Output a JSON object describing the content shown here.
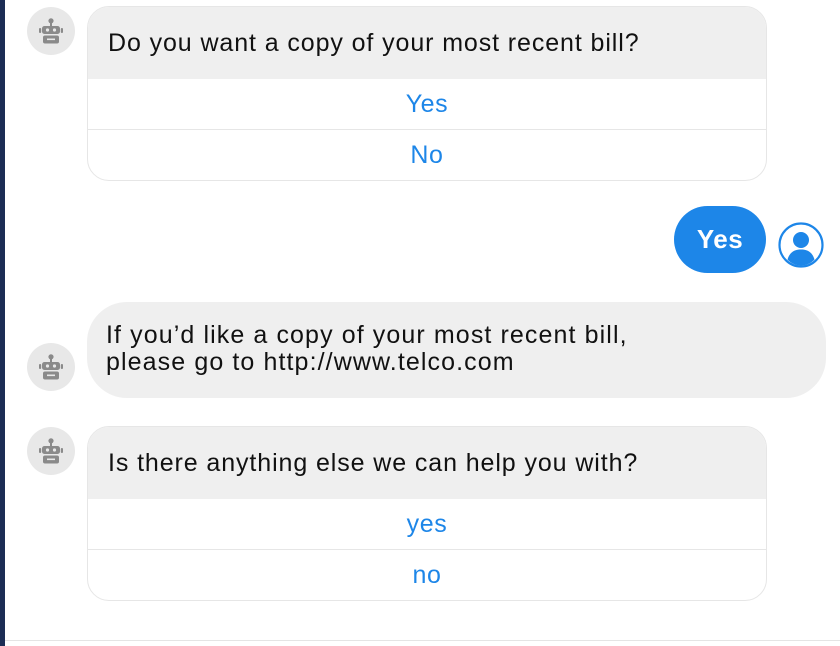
{
  "conversation": {
    "q1": {
      "prompt": "Do you want a copy of your most recent bill?",
      "options": [
        "Yes",
        "No"
      ]
    },
    "user_reply": "Yes",
    "bot_message": {
      "line1": "If you’d like a copy of your most recent bill,",
      "line2": "please go to http://www.telco.com"
    },
    "q2": {
      "prompt": "Is there anything else we can help you with?",
      "options": [
        "yes",
        "no"
      ]
    }
  },
  "icons": {
    "bot": "robot-icon",
    "user": "user-icon"
  },
  "colors": {
    "accent": "#1d86e8",
    "bubble_bg": "#efefef",
    "avatar_bg": "#e8e8e8",
    "robot_gray": "#8a8a8a",
    "left_edge": "#1c2d55"
  }
}
